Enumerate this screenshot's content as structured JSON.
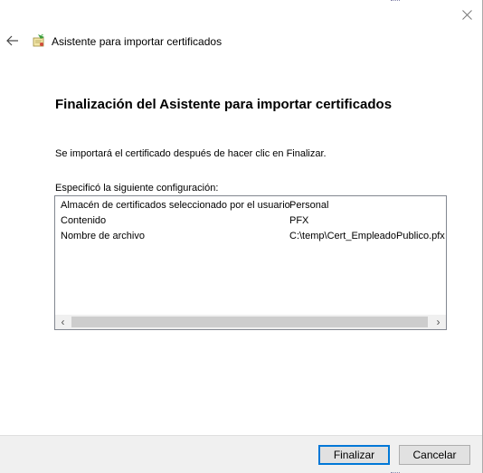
{
  "window": {
    "title": "Asistente para importar certificados"
  },
  "icons": {
    "back": "back-arrow-icon",
    "app": "certificate-wizard-icon",
    "close": "close-icon"
  },
  "main": {
    "heading": "Finalización del Asistente para importar certificados",
    "info_text": "Se importará el certificado después de hacer clic en Finalizar.",
    "config_label": "Especificó la siguiente configuración:",
    "settings": [
      {
        "key": "Almacén de certificados seleccionado por el usuario",
        "value": "Personal"
      },
      {
        "key": "Contenido",
        "value": "PFX"
      },
      {
        "key": "Nombre de archivo",
        "value": "C:\\temp\\Cert_EmpleadoPublico.pfx"
      }
    ],
    "scroll_left": "‹",
    "scroll_right": "›"
  },
  "footer": {
    "finish_label": "Finalizar",
    "cancel_label": "Cancelar"
  },
  "colors": {
    "accent": "#0078d7",
    "footer_bg": "#f0f0f0"
  }
}
